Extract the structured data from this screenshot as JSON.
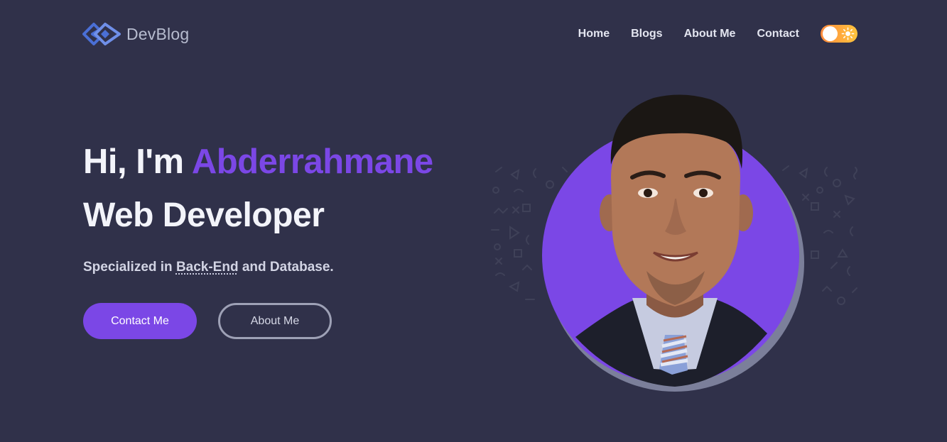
{
  "brand": {
    "name": "DevBlog",
    "icon": "devblog-logo-icon"
  },
  "nav": {
    "items": [
      {
        "label": "Home"
      },
      {
        "label": "Blogs"
      },
      {
        "label": "About Me"
      },
      {
        "label": "Contact"
      }
    ]
  },
  "theme_toggle": {
    "icon": "sun-icon",
    "state": "light"
  },
  "hero": {
    "greeting": "Hi, I'm ",
    "name": "Abderrahmane",
    "role": "Web Developer",
    "desc_prefix": "Specialized in ",
    "desc_highlight": "Back-End",
    "desc_suffix": " and Database."
  },
  "buttons": {
    "contact": "Contact Me",
    "about": "About Me"
  },
  "colors": {
    "background": "#30314a",
    "accent": "#7b47e6",
    "toggle_start": "#ff8a3d",
    "toggle_end": "#ffc53d"
  }
}
